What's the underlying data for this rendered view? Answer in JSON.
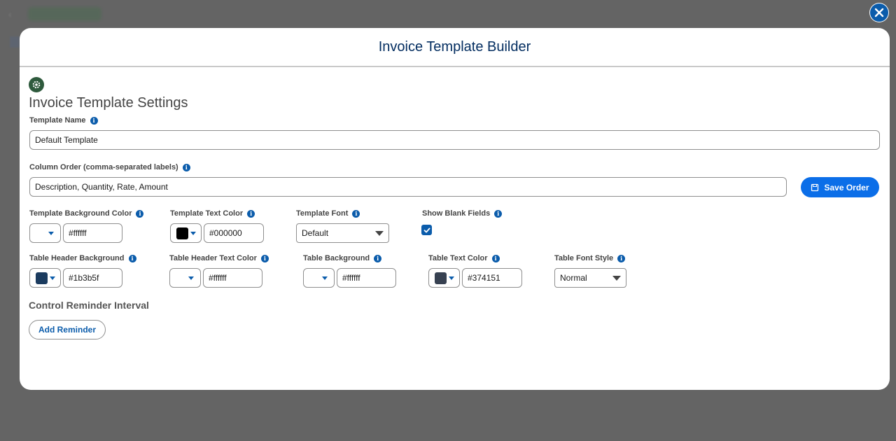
{
  "modal": {
    "title": "Invoice Template Builder"
  },
  "settings": {
    "section_title": "Invoice Template Settings",
    "template_name": {
      "label": "Template Name",
      "value": "Default Template"
    },
    "column_order": {
      "label": "Column Order (comma-separated labels)",
      "value": "Description, Quantity, Rate, Amount"
    },
    "save_order_label": "Save Order",
    "template_background_color": {
      "label": "Template Background Color",
      "value": "#ffffff",
      "swatch": "#ffffff"
    },
    "template_text_color": {
      "label": "Template Text Color",
      "value": "#000000",
      "swatch": "#000000"
    },
    "template_font": {
      "label": "Template Font",
      "value": "Default"
    },
    "show_blank_fields": {
      "label": "Show Blank Fields",
      "checked": true
    },
    "table_header_background": {
      "label": "Table Header Background",
      "value": "#1b3b5f",
      "swatch": "#1b3b5f"
    },
    "table_header_text_color": {
      "label": "Table Header Text Color",
      "value": "#ffffff",
      "swatch": "#ffffff"
    },
    "table_background": {
      "label": "Table Background",
      "value": "#ffffff",
      "swatch": "#ffffff"
    },
    "table_text_color": {
      "label": "Table Text Color",
      "value": "#374151",
      "swatch": "#374151"
    },
    "table_font_style": {
      "label": "Table Font Style",
      "value": "Normal"
    }
  },
  "reminders": {
    "title": "Control Reminder Interval",
    "add_label": "Add Reminder"
  },
  "colors": {
    "brand_blue": "#0b5cab",
    "button_blue": "#0b6ee8",
    "title_navy": "#032d60"
  }
}
